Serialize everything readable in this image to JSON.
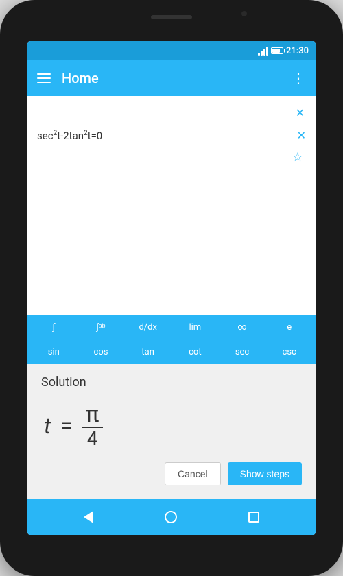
{
  "statusBar": {
    "time": "21:30"
  },
  "appBar": {
    "title": "Home"
  },
  "equations": [
    {
      "text": "sec²t-2tan²t=0",
      "hasStar": true
    }
  ],
  "keyboard": {
    "row1": [
      "∫",
      "∫ᵃᵇ",
      "d/dx",
      "lim",
      "∞",
      "e"
    ],
    "row2": [
      "sin",
      "cos",
      "tan",
      "cot",
      "sec",
      "csc"
    ]
  },
  "solution": {
    "title": "Solution",
    "math": "t = π/4",
    "t": "t",
    "equals": "=",
    "numerator": "π",
    "denominator": "4"
  },
  "buttons": {
    "cancel": "Cancel",
    "showSteps": "Show steps"
  },
  "nav": {
    "back": "back",
    "home": "home",
    "recent": "recent"
  }
}
